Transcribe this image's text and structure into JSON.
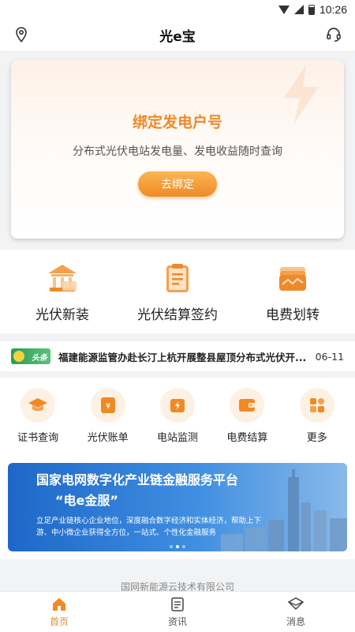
{
  "status_bar": {
    "time": "10:26"
  },
  "header": {
    "title": "光e宝"
  },
  "bind_card": {
    "title": "绑定发电户号",
    "subtitle": "分布式光伏电站发电量、发电收益随时查询",
    "button": "去绑定"
  },
  "main_services": [
    {
      "label": "光伏新装"
    },
    {
      "label": "光伏结算签约"
    },
    {
      "label": "电费划转"
    }
  ],
  "news": {
    "badge": "头条",
    "text": "福建能源监管办赴长汀上杭开展整县屋顶分布式光伏开...",
    "date": "06-11"
  },
  "quick_actions": [
    {
      "label": "证书查询"
    },
    {
      "label": "光伏账单"
    },
    {
      "label": "电站监测"
    },
    {
      "label": "电费结算"
    },
    {
      "label": "更多"
    }
  ],
  "banner": {
    "title": "国家电网数字化产业链金融服务平台",
    "subtitle": "“电e金服”",
    "description": "立足产业链核心企业地位，深度融合数字经济和实体经济，帮助上下游、中小微企业获得全方位，一站式、个性化金融服务"
  },
  "footer": {
    "company": "国网新能源云技术有限公司"
  },
  "tabbar": [
    {
      "label": "首页",
      "active": true
    },
    {
      "label": "资讯",
      "active": false
    },
    {
      "label": "消息",
      "active": false
    }
  ],
  "colors": {
    "accent": "#f08a25",
    "banner": "#1e67c8"
  }
}
